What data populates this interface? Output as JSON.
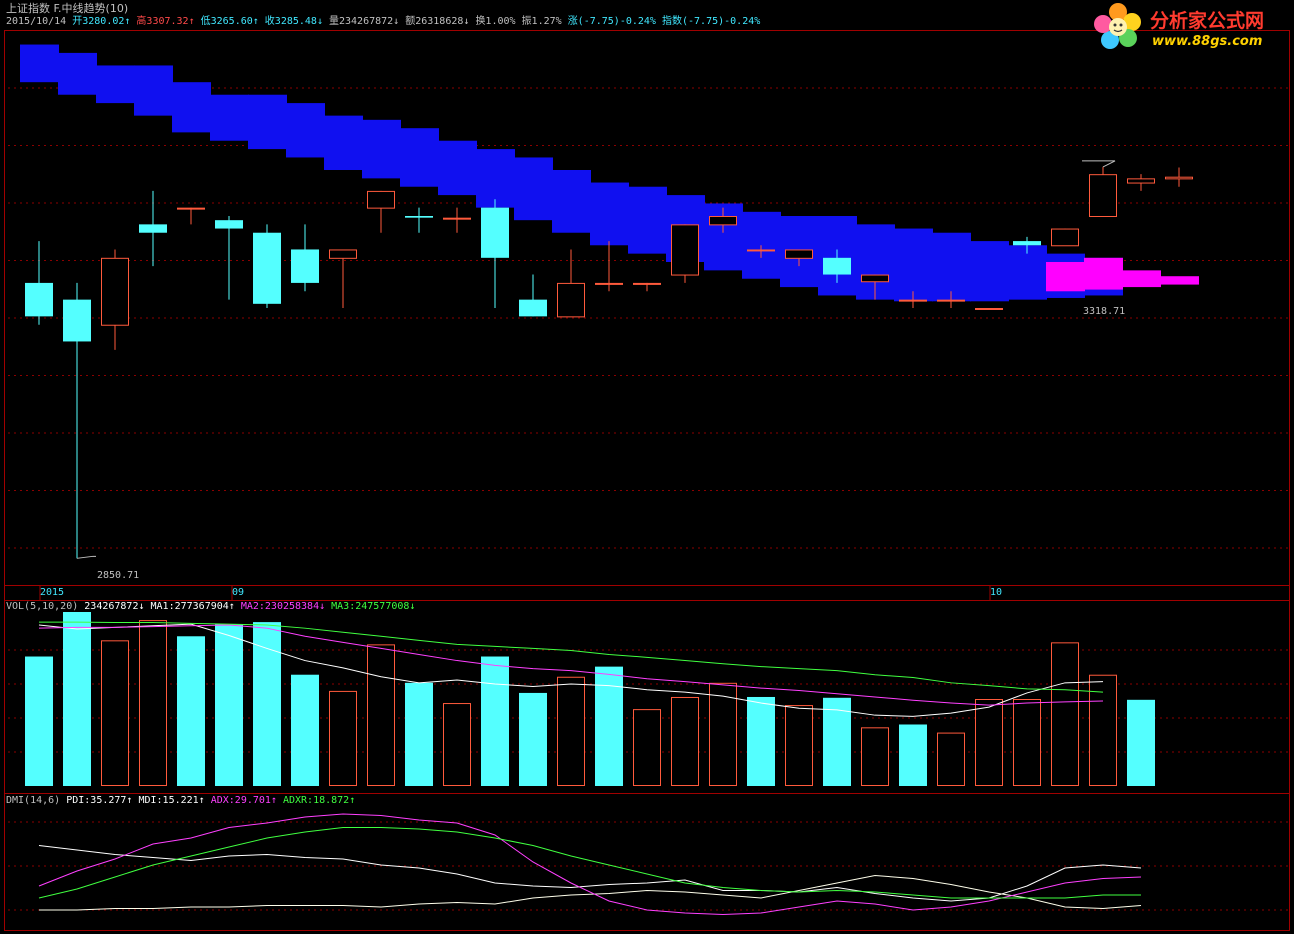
{
  "header": {
    "title": "上证指数 F.中线趋势(10)",
    "date": "2015/10/14",
    "items": [
      {
        "text": "开3280.02↑",
        "color": "#40e8ff"
      },
      {
        "text": "高3307.32↑",
        "color": "#ff4a4a"
      },
      {
        "text": "低3265.60↑",
        "color": "#40e8ff"
      },
      {
        "text": "收3285.48↓",
        "color": "#40e8ff"
      },
      {
        "text": "量234267872↓",
        "color": "#c0c0c0"
      },
      {
        "text": "额26318628↓",
        "color": "#c0c0c0"
      },
      {
        "text": "换1.00%",
        "color": "#c0c0c0"
      },
      {
        "text": "振1.27%",
        "color": "#c0c0c0"
      },
      {
        "text": "涨(-7.75)-0.24%",
        "color": "#40e8ff"
      },
      {
        "text": "指数(-7.75)-0.24%",
        "color": "#40e8ff"
      }
    ]
  },
  "logo": {
    "title": "分析家公式网",
    "url": "www.88gs.com"
  },
  "colors": {
    "up": "#ff5a3c",
    "down": "#54ffff",
    "band": "#1010f0",
    "band_top": "#ff00ff",
    "ma1": "#ffffff",
    "ma2": "#ff40ff",
    "ma3": "#40ff40",
    "grid": "#8b0000"
  },
  "annotations": {
    "low": "2850.71",
    "high": "3318.71"
  },
  "xaxis": {
    "labels": [
      "2015",
      "09",
      "10"
    ]
  },
  "chart_data": [
    {
      "type": "candlestick",
      "title": "上证指数 F.中线趋势(10)",
      "ylim": [
        2820,
        3480
      ],
      "candles": [
        {
          "o": 3180,
          "h": 3230,
          "l": 3130,
          "c": 3140
        },
        {
          "o": 3160,
          "h": 3180,
          "l": 2850.71,
          "c": 3110
        },
        {
          "o": 3130,
          "h": 3220,
          "l": 3100,
          "c": 3210
        },
        {
          "o": 3250,
          "h": 3290,
          "l": 3200,
          "c": 3240
        },
        {
          "o": 3270,
          "h": 3270,
          "l": 3250,
          "c": 3270
        },
        {
          "o": 3255,
          "h": 3260,
          "l": 3160,
          "c": 3245
        },
        {
          "o": 3240,
          "h": 3250,
          "l": 3150,
          "c": 3155
        },
        {
          "o": 3220,
          "h": 3250,
          "l": 3170,
          "c": 3180
        },
        {
          "o": 3210,
          "h": 3220,
          "l": 3150,
          "c": 3220
        },
        {
          "o": 3270,
          "h": 3290,
          "l": 3240,
          "c": 3290
        },
        {
          "o": 3260,
          "h": 3270,
          "l": 3240,
          "c": 3258
        },
        {
          "o": 3258,
          "h": 3270,
          "l": 3240,
          "c": 3258
        },
        {
          "o": 3270,
          "h": 3280,
          "l": 3150,
          "c": 3210
        },
        {
          "o": 3160,
          "h": 3190,
          "l": 3140,
          "c": 3140
        },
        {
          "o": 3140,
          "h": 3220,
          "l": 3140,
          "c": 3180
        },
        {
          "o": 3180,
          "h": 3230,
          "l": 3170,
          "c": 3180
        },
        {
          "o": 3180,
          "h": 3180,
          "l": 3170,
          "c": 3180
        },
        {
          "o": 3190,
          "h": 3250,
          "l": 3180,
          "c": 3250
        },
        {
          "o": 3250,
          "h": 3270,
          "l": 3240,
          "c": 3260
        },
        {
          "o": 3220,
          "h": 3225,
          "l": 3210,
          "c": 3220
        },
        {
          "o": 3210,
          "h": 3220,
          "l": 3200,
          "c": 3220
        },
        {
          "o": 3210,
          "h": 3220,
          "l": 3180,
          "c": 3190
        },
        {
          "o": 3182,
          "h": 3190,
          "l": 3160,
          "c": 3190
        },
        {
          "o": 3160,
          "h": 3170,
          "l": 3150,
          "c": 3160
        },
        {
          "o": 3160,
          "h": 3170,
          "l": 3150,
          "c": 3160
        },
        {
          "o": 3150,
          "h": 3150,
          "l": 3150,
          "c": 3150
        },
        {
          "o": 3230,
          "h": 3235,
          "l": 3215,
          "c": 3225
        },
        {
          "o": 3225,
          "h": 3245,
          "l": 3225,
          "c": 3245
        },
        {
          "o": 3260,
          "h": 3318.71,
          "l": 3260,
          "c": 3310
        },
        {
          "o": 3300,
          "h": 3310,
          "l": 3290,
          "c": 3305
        },
        {
          "o": 3305,
          "h": 3318,
          "l": 3295,
          "c": 3307
        }
      ],
      "band": [
        {
          "top": 3465,
          "bottom": 3420
        },
        {
          "top": 3455,
          "bottom": 3405
        },
        {
          "top": 3440,
          "bottom": 3395
        },
        {
          "top": 3440,
          "bottom": 3380
        },
        {
          "top": 3420,
          "bottom": 3360
        },
        {
          "top": 3405,
          "bottom": 3350
        },
        {
          "top": 3405,
          "bottom": 3340
        },
        {
          "top": 3395,
          "bottom": 3330
        },
        {
          "top": 3380,
          "bottom": 3315
        },
        {
          "top": 3375,
          "bottom": 3305
        },
        {
          "top": 3365,
          "bottom": 3295
        },
        {
          "top": 3350,
          "bottom": 3285
        },
        {
          "top": 3340,
          "bottom": 3270
        },
        {
          "top": 3330,
          "bottom": 3255
        },
        {
          "top": 3315,
          "bottom": 3240
        },
        {
          "top": 3300,
          "bottom": 3225
        },
        {
          "top": 3295,
          "bottom": 3215
        },
        {
          "top": 3285,
          "bottom": 3205
        },
        {
          "top": 3275,
          "bottom": 3195
        },
        {
          "top": 3265,
          "bottom": 3185
        },
        {
          "top": 3260,
          "bottom": 3175
        },
        {
          "top": 3260,
          "bottom": 3165
        },
        {
          "top": 3250,
          "bottom": 3160
        },
        {
          "top": 3245,
          "bottom": 3158
        },
        {
          "top": 3240,
          "bottom": 3158
        },
        {
          "top": 3230,
          "bottom": 3158
        },
        {
          "top": 3225,
          "bottom": 3160
        },
        {
          "top": 3215,
          "bottom": 3162
        },
        {
          "top": 3210,
          "bottom": 3165
        }
      ],
      "band_magenta": [
        {
          "top": 3205,
          "bottom": 3170
        },
        {
          "top": 3210,
          "bottom": 3172
        },
        {
          "top": 3195,
          "bottom": 3175
        },
        {
          "top": 3188,
          "bottom": 3178
        }
      ]
    },
    {
      "type": "bar",
      "title": "VOL(5,10,20)",
      "legend": [
        {
          "text": "VOL(5,10,20)",
          "color": "#c0c0c0"
        },
        {
          "text": "234267872↓",
          "color": "#ffffff"
        },
        {
          "text": "MA1:277367904↑",
          "color": "#ffffff"
        },
        {
          "text": "MA2:230258384↓",
          "color": "#ff40ff"
        },
        {
          "text": "MA3:247577008↓",
          "color": "#40ff40"
        }
      ],
      "ylim": [
        0,
        430000000
      ],
      "volumes": [
        {
          "v": 320000000,
          "up": false
        },
        {
          "v": 430000000,
          "up": false
        },
        {
          "v": 360000000,
          "up": true
        },
        {
          "v": 410000000,
          "up": true
        },
        {
          "v": 370000000,
          "up": false
        },
        {
          "v": 400000000,
          "up": false
        },
        {
          "v": 405000000,
          "up": false
        },
        {
          "v": 275000000,
          "up": false
        },
        {
          "v": 235000000,
          "up": true
        },
        {
          "v": 350000000,
          "up": true
        },
        {
          "v": 255000000,
          "up": false
        },
        {
          "v": 205000000,
          "up": true
        },
        {
          "v": 320000000,
          "up": false
        },
        {
          "v": 230000000,
          "up": false
        },
        {
          "v": 270000000,
          "up": true
        },
        {
          "v": 295000000,
          "up": false
        },
        {
          "v": 190000000,
          "up": true
        },
        {
          "v": 220000000,
          "up": true
        },
        {
          "v": 255000000,
          "up": true
        },
        {
          "v": 220000000,
          "up": false
        },
        {
          "v": 200000000,
          "up": true
        },
        {
          "v": 218000000,
          "up": false
        },
        {
          "v": 145000000,
          "up": true
        },
        {
          "v": 152000000,
          "up": false
        },
        {
          "v": 132000000,
          "up": true
        },
        {
          "v": 215000000,
          "up": true
        },
        {
          "v": 215000000,
          "up": true
        },
        {
          "v": 355000000,
          "up": true
        },
        {
          "v": 275000000,
          "up": true
        },
        {
          "v": 213000000,
          "up": false
        }
      ],
      "ma1": [
        398,
        388,
        392,
        396,
        400,
        372,
        340,
        310,
        292,
        270,
        255,
        262,
        252,
        246,
        252,
        248,
        238,
        232,
        222,
        205,
        192,
        188,
        175,
        172,
        180,
        195,
        230,
        255,
        258
      ],
      "ma2": [
        390,
        392,
        392,
        394,
        396,
        398,
        390,
        370,
        355,
        340,
        325,
        310,
        298,
        290,
        285,
        276,
        265,
        258,
        250,
        242,
        236,
        228,
        220,
        212,
        205,
        200,
        205,
        208,
        210
      ],
      "ma3": [
        405,
        405,
        404,
        404,
        402,
        400,
        398,
        390,
        380,
        370,
        360,
        350,
        345,
        340,
        335,
        325,
        318,
        310,
        302,
        295,
        290,
        285,
        275,
        268,
        255,
        248,
        240,
        238,
        232
      ]
    },
    {
      "type": "line",
      "title": "DMI(14,6)",
      "legend": [
        {
          "text": "DMI(14,6)",
          "color": "#c0c0c0"
        },
        {
          "text": "PDI:35.277↑",
          "color": "#ffffff"
        },
        {
          "text": "MDI:15.221↑",
          "color": "#ffffff"
        },
        {
          "text": "ADX:29.701↑",
          "color": "#ff40ff"
        },
        {
          "text": "ADXR:18.872↑",
          "color": "#40ff40"
        }
      ],
      "ylim": [
        0,
        80
      ],
      "series": [
        {
          "name": "PDI",
          "color": "#ffffff",
          "values": [
            55,
            52,
            49,
            47,
            45,
            48,
            49,
            47,
            46,
            42,
            40,
            36,
            30,
            28,
            27,
            29,
            30,
            32,
            25,
            25,
            24,
            27,
            23,
            20,
            18,
            20,
            28,
            40,
            42,
            40
          ]
        },
        {
          "name": "MDI",
          "color": "#ffffeb",
          "values": [
            12,
            12,
            13,
            13,
            14,
            14,
            15,
            15,
            15,
            14,
            16,
            17,
            16,
            20,
            22,
            23,
            25,
            24,
            22,
            20,
            25,
            30,
            35,
            33,
            29,
            24,
            20,
            14,
            13,
            15
          ]
        },
        {
          "name": "ADX",
          "color": "#ff40ff",
          "values": [
            28,
            38,
            46,
            56,
            60,
            67,
            70,
            74,
            76,
            75,
            72,
            70,
            62,
            44,
            30,
            18,
            12,
            10,
            9,
            10,
            14,
            18,
            16,
            12,
            14,
            18,
            24,
            30,
            33,
            34
          ]
        },
        {
          "name": "ADXR",
          "color": "#40ff40",
          "values": [
            20,
            26,
            34,
            42,
            48,
            54,
            60,
            64,
            67,
            67,
            66,
            64,
            60,
            55,
            48,
            42,
            36,
            30,
            27,
            25,
            24,
            25,
            24,
            22,
            20,
            20,
            20,
            20,
            22,
            22
          ]
        }
      ]
    }
  ]
}
